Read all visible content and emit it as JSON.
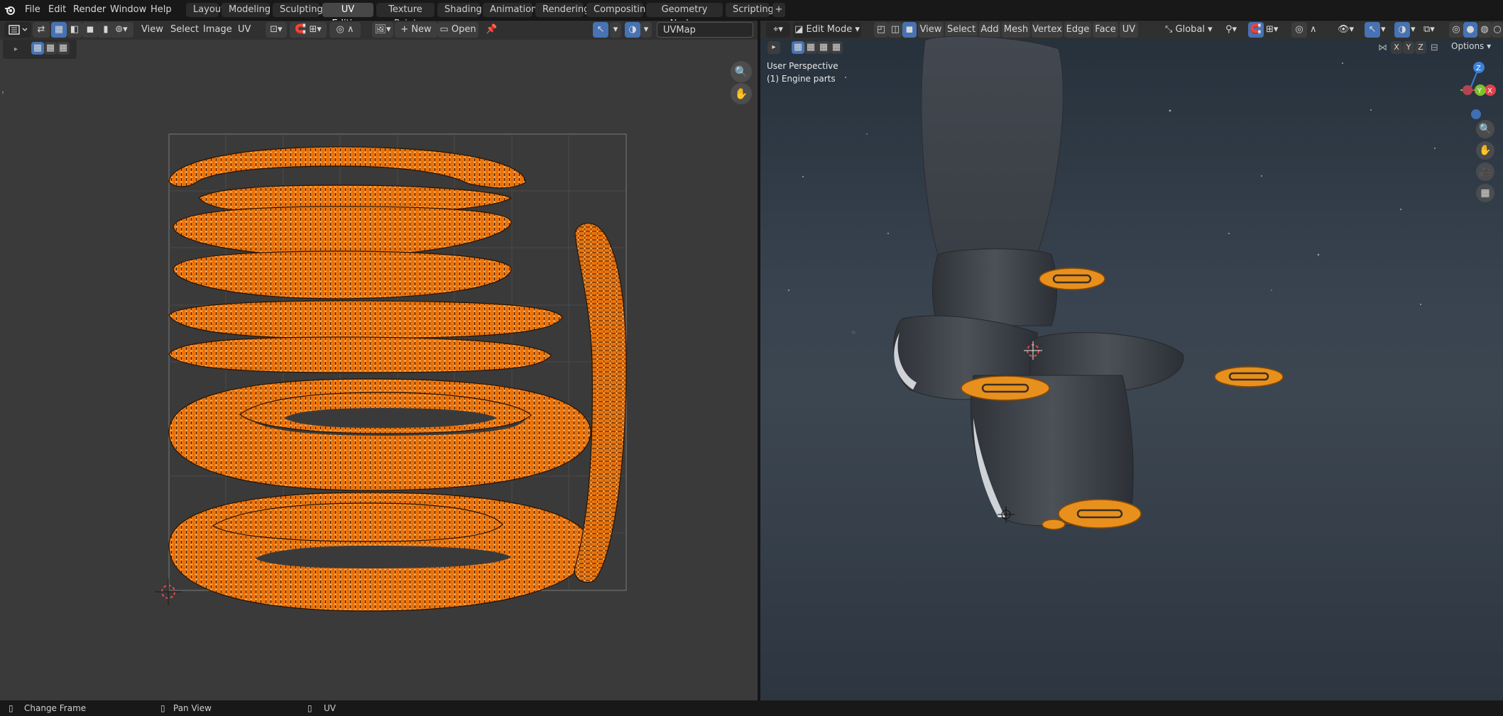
{
  "topbar": {
    "menus": [
      "File",
      "Edit",
      "Render",
      "Window",
      "Help"
    ],
    "workspaces": [
      "Layout",
      "Modeling",
      "Sculpting",
      "UV Editing",
      "Texture Paint",
      "Shading",
      "Animation",
      "Rendering",
      "Compositing",
      "Geometry Nodes",
      "Scripting"
    ],
    "active_workspace": "UV Editing",
    "add_tab_label": "+"
  },
  "uv_editor": {
    "menus": [
      "View",
      "Select",
      "Image",
      "UV"
    ],
    "new_label": "New",
    "open_label": "Open",
    "uvmap_name": "UVMap"
  },
  "viewport": {
    "mode_label": "Edit Mode",
    "menus": [
      "View",
      "Select",
      "Add",
      "Mesh",
      "Vertex",
      "Edge",
      "Face",
      "UV"
    ],
    "transform_orientation": "Global",
    "options_label": "Options",
    "axis_buttons": [
      "X",
      "Y",
      "Z"
    ],
    "perspective_label": "User Perspective",
    "object_label": "(1) Engine parts",
    "gizmo": {
      "x": "X",
      "y": "Y",
      "z": "Z"
    }
  },
  "statusbar": {
    "items": [
      "Change Frame",
      "Pan View",
      "UV"
    ]
  },
  "colors": {
    "accent": "#4772b3",
    "uv_orange": "#f08a1a",
    "background": "#3a3a3a",
    "gizmo_x": "#e0434e",
    "gizmo_y": "#7fbf2f",
    "gizmo_z": "#3e80d8"
  },
  "icons": [
    "blender-logo-icon",
    "editor-type-icon",
    "sync-selection-icon",
    "vertex-select-icon",
    "edge-select-icon",
    "face-select-icon",
    "island-select-icon",
    "pivot-icon",
    "snap-icon",
    "proportional-edit-icon",
    "image-icon",
    "pin-icon",
    "zoom-icon",
    "hand-pan-icon",
    "camera-icon",
    "grid-icon",
    "overlay-icon",
    "gizmo-icon",
    "cursor-icon"
  ]
}
